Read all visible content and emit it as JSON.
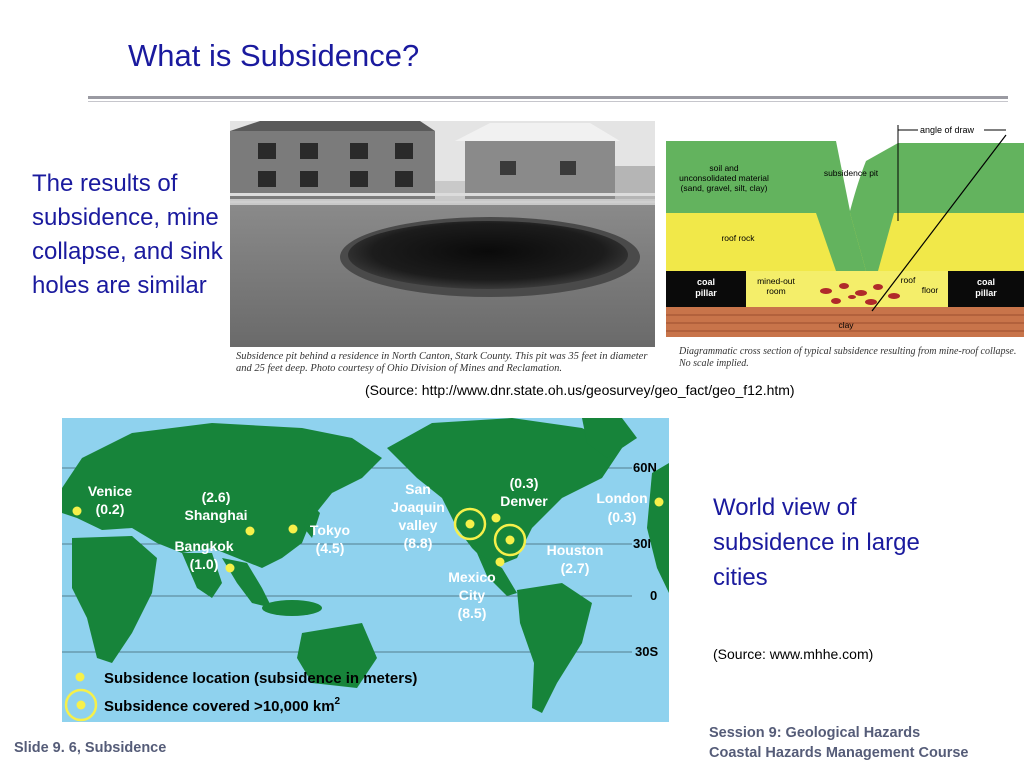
{
  "slide": {
    "title": "What is Subsidence?",
    "intro_text": "The results of subsidence, mine collapse, and sink holes are similar",
    "photo_caption": "Subsidence pit behind a residence in North Canton, Stark County. This pit was 35 feet in diameter and 25 feet deep. Photo courtesy of Ohio Division of Mines and Reclamation.",
    "source_1": "(Source: http://www.dnr.state.oh.us/geosurvey/geo_fact/geo_f12.htm)",
    "world_text": "World view of subsidence in large cities",
    "source_2": "(Source: www.mhhe.com)",
    "session_line_1": "Session 9: Geological Hazards",
    "session_line_2": "Coastal Hazards Management Course",
    "slide_number": "Slide 9. 6, Subsidence"
  },
  "diagram": {
    "angle_of_draw": "angle of draw",
    "soil_line_1": "soil and",
    "soil_line_2": "unconsolidated material",
    "soil_line_3": "(sand, gravel, silt, clay)",
    "subsidence_pit": "subsidence pit",
    "roof_rock": "roof rock",
    "coal_1": "coal",
    "pillar_1": "pillar",
    "mined_1": "mined-out",
    "mined_2": "room",
    "roof": "roof",
    "floor": "floor",
    "coal_2": "coal",
    "pillar_2": "pillar",
    "clay": "clay",
    "caption": "Diagrammatic cross section of typical subsidence resulting from mine-roof collapse. No scale implied."
  },
  "map": {
    "lat_60": "60N",
    "lat_30": "30N",
    "lat_0": "0",
    "lat_m30": "30S",
    "cities": {
      "venice_name": "Venice",
      "venice_value": "(0.2)",
      "shanghai_value": "(2.6)",
      "shanghai_name": "Shanghai",
      "tokyo_name": "Tokyo",
      "tokyo_value": "(4.5)",
      "bangkok_name": "Bangkok",
      "bangkok_value": "(1.0)",
      "sj_1": "San",
      "sj_2": "Joaquin",
      "sj_3": "valley",
      "sj_value": "(8.8)",
      "denver_value": "(0.3)",
      "denver_name": "Denver",
      "london_name": "London",
      "london_value": "(0.3)",
      "houston_name": "Houston",
      "houston_value": "(2.7)",
      "mexico_1": "Mexico",
      "mexico_2": "City",
      "mexico_value": "(8.5)"
    },
    "legend_location": "Subsidence location (subsidence  in meters)",
    "legend_covered": "Subsidence covered >10,000 km",
    "legend_covered_sup": "2",
    "colors": {
      "ocean": "#8fd2ee",
      "land": "#17843a",
      "marker": "#f6f04a"
    }
  }
}
